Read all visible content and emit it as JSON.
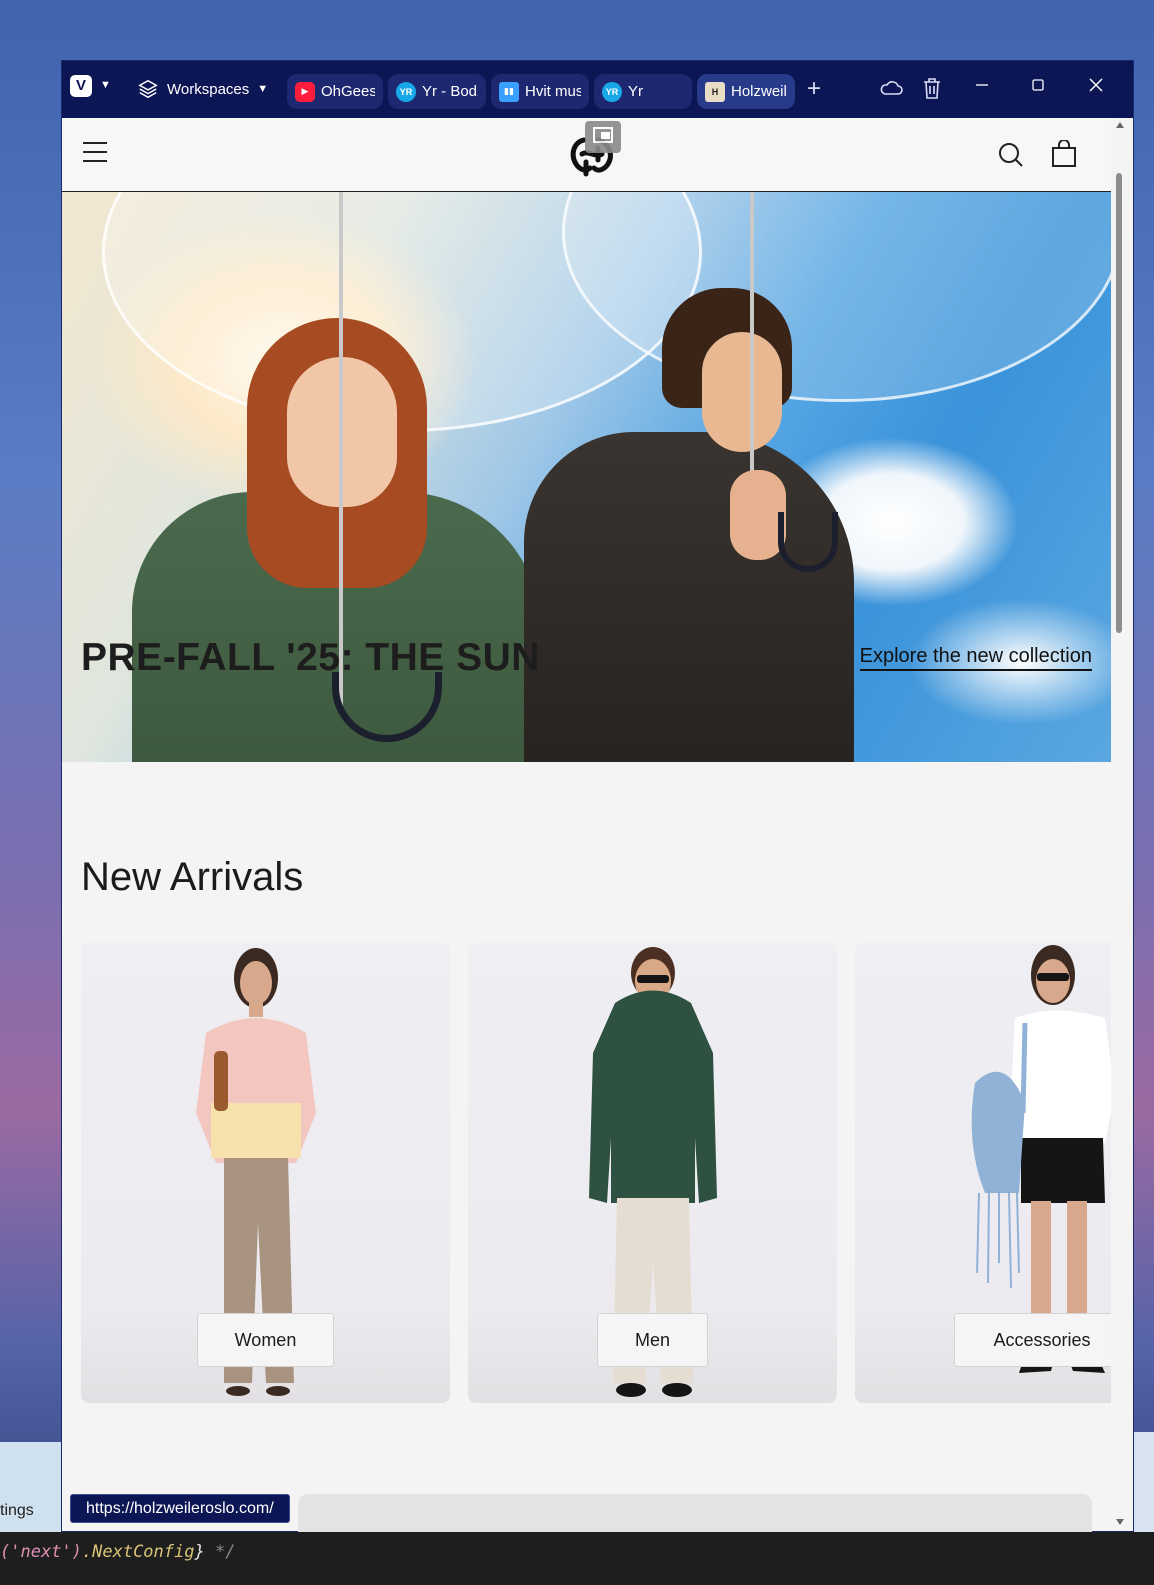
{
  "desktop": {
    "left_label": "tings",
    "code_line": {
      "part1": "('next')",
      "part2": ".NextConfig",
      "part3": "}",
      "part4": " */"
    }
  },
  "browser": {
    "workspaces_label": "Workspaces",
    "tabs": [
      {
        "title": "OhGeesy",
        "favicon": "youtube-icon"
      },
      {
        "title": "Yr - Bodø",
        "favicon": "yr-icon"
      },
      {
        "title": "Hvit mus",
        "favicon": "book-icon"
      },
      {
        "title": "Yr",
        "favicon": "yr-icon"
      },
      {
        "title": "Holzweiler",
        "favicon": "holzweiler-icon"
      }
    ],
    "new_tab_label": "+",
    "status_url": "https://holzweileroslo.com/"
  },
  "site": {
    "hero": {
      "title": "PRE-FALL '25: THE SUN",
      "link": "Explore the new collection"
    },
    "section_title": "New Arrivals",
    "categories": [
      {
        "label": "Women"
      },
      {
        "label": "Men"
      },
      {
        "label": "Accessories"
      }
    ]
  }
}
